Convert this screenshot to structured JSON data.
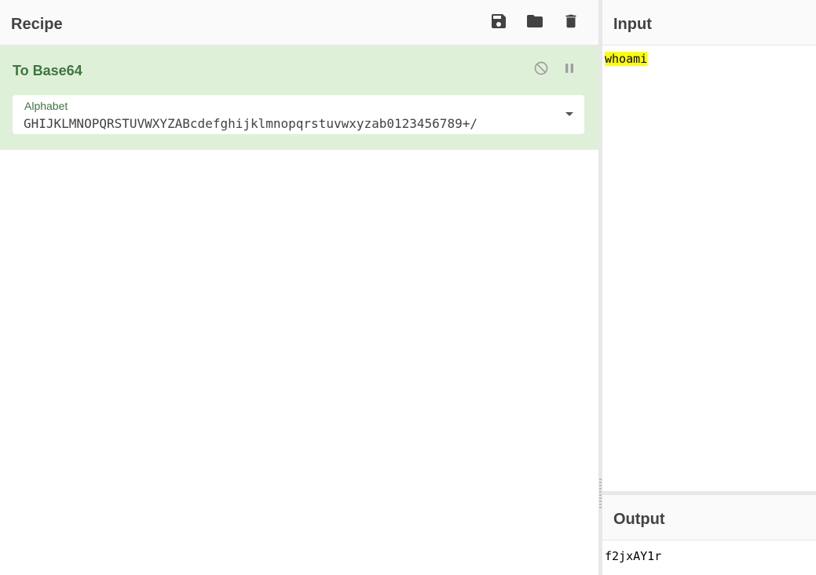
{
  "recipe": {
    "title": "Recipe",
    "icons": [
      "save-icon",
      "folder-icon",
      "trash-icon"
    ]
  },
  "operation": {
    "name": "To Base64",
    "icons": [
      "disable-icon",
      "pause-icon"
    ],
    "args": [
      {
        "label": "Alphabet",
        "value": "GHIJKLMNOPQRSTUVWXYZABcdefghijklmnopqrstuvwxyzab0123456789+/"
      }
    ]
  },
  "input": {
    "title": "Input",
    "text": "whoami"
  },
  "output": {
    "title": "Output",
    "text": "f2jxAY1r"
  },
  "colors": {
    "operation_bg": "#dff0d8",
    "operation_text": "#3c763d",
    "highlight": "#ffff00"
  }
}
